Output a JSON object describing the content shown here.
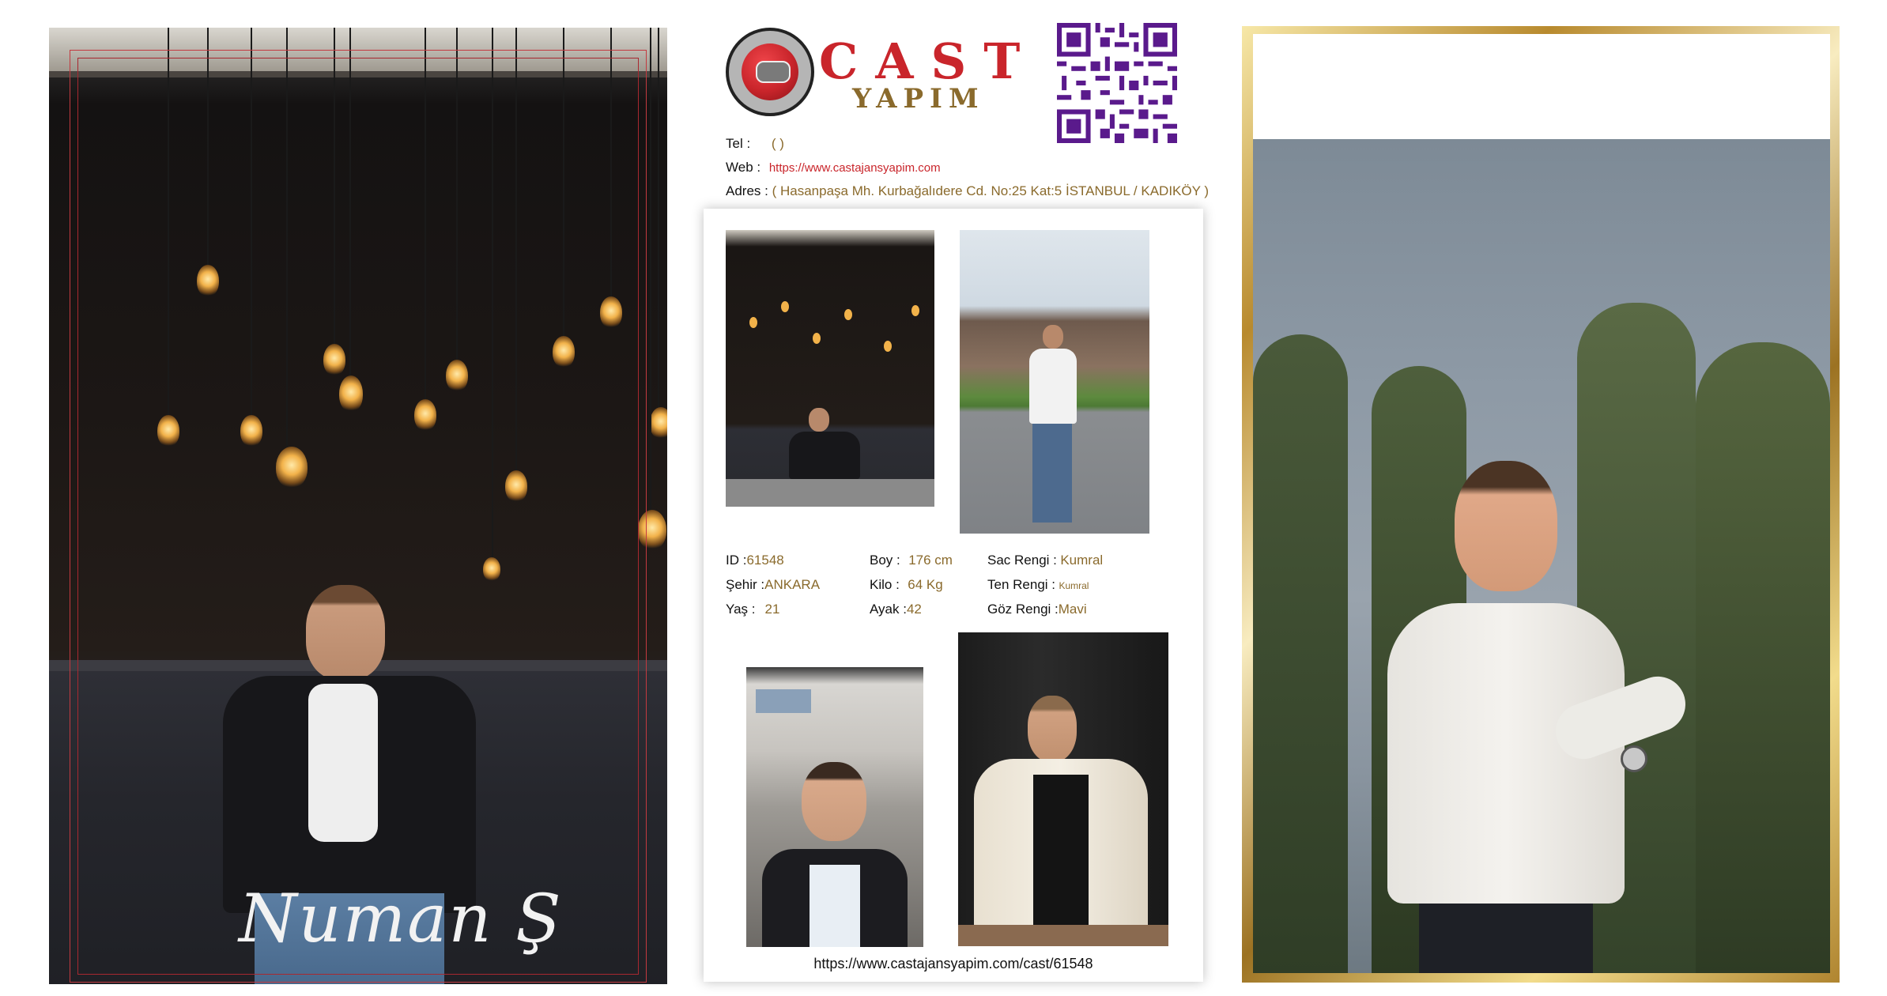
{
  "model_name": "Numan Ş",
  "brand": {
    "top": "CAST",
    "bottom": "YAPIM"
  },
  "contact": {
    "tel_label": "Tel :",
    "tel_value": "( )",
    "web_label": "Web :",
    "web_value": "https://www.castajansyapim.com",
    "address_label": "Adres :",
    "address_value": "( Hasanpaşa Mh. Kurbağalıdere Cd. No:25 Kat:5 İSTANBUL / KADIKÖY )"
  },
  "stats": {
    "id_label": "ID :",
    "id_value": "61548",
    "city_label": "Şehir :",
    "city_value": "ANKARA",
    "age_label": "Yaş :",
    "age_value": "21",
    "height_label": "Boy :",
    "height_value": "176 cm",
    "weight_label": "Kilo :",
    "weight_value": "64 Kg",
    "foot_label": "Ayak :",
    "foot_value": "42",
    "hair_label": "Sac Rengi :",
    "hair_value": "Kumral",
    "skin_label": "Ten Rengi :",
    "skin_value": "Kumral",
    "eye_label": "Göz Rengi :",
    "eye_value": "Mavi"
  },
  "footer_url": "https://www.castajansyapim.com/cast/61548",
  "colors": {
    "brand_red": "#c9252b",
    "gold": "#c8a24a",
    "qr_purple": "#5a1a8c",
    "value_gold": "#8a6a2c"
  },
  "icons": {
    "logo": "cast-logo-icon",
    "qr": "qr-code-icon"
  }
}
